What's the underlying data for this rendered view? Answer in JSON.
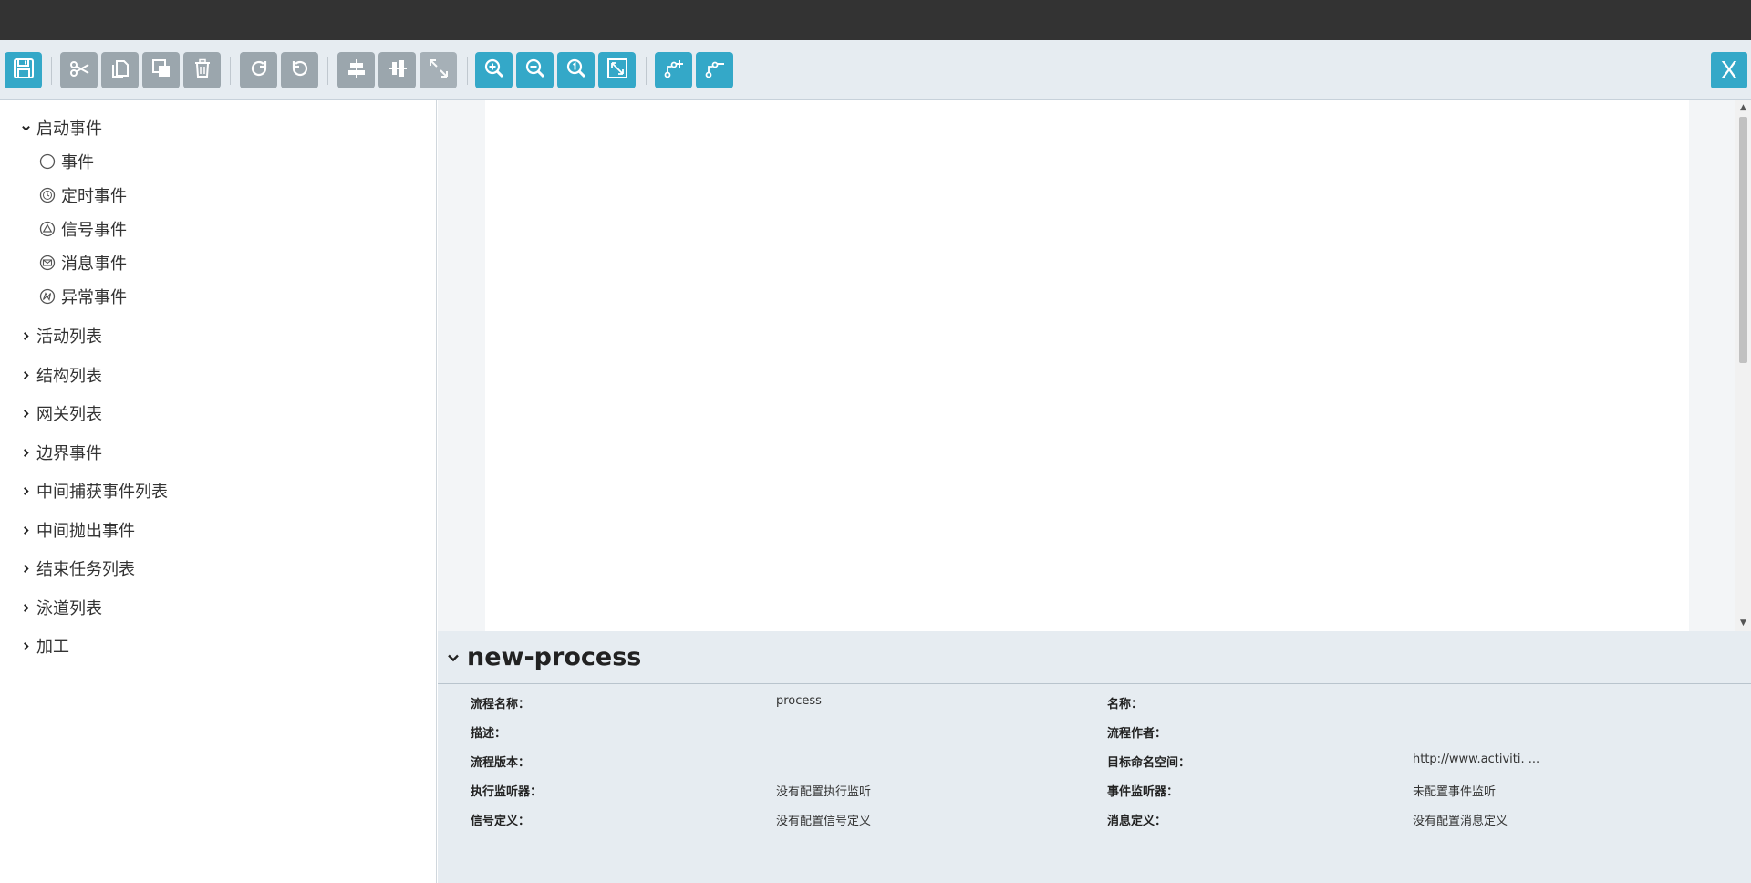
{
  "toolbar": {
    "buttons": [
      {
        "name": "save-button",
        "icon": "save-icon"
      },
      {
        "name": "cut-button",
        "icon": "scissors-icon"
      },
      {
        "name": "copy-button",
        "icon": "copy-icon"
      },
      {
        "name": "paste-button",
        "icon": "paste-icon"
      },
      {
        "name": "delete-button",
        "icon": "trash-icon"
      },
      {
        "name": "redo-button",
        "icon": "redo-icon"
      },
      {
        "name": "undo-button",
        "icon": "undo-icon"
      },
      {
        "name": "align-horizontal-button",
        "icon": "align-horizontal-icon"
      },
      {
        "name": "align-vertical-button",
        "icon": "align-vertical-icon"
      },
      {
        "name": "same-size-button",
        "icon": "resize-icon"
      },
      {
        "name": "zoom-in-button",
        "icon": "zoom-in-icon"
      },
      {
        "name": "zoom-out-button",
        "icon": "zoom-out-icon"
      },
      {
        "name": "zoom-actual-button",
        "icon": "zoom-actual-icon"
      },
      {
        "name": "zoom-fit-button",
        "icon": "fit-screen-icon"
      },
      {
        "name": "add-bendpoint-button",
        "icon": "add-bendpoint-icon"
      },
      {
        "name": "remove-bendpoint-button",
        "icon": "remove-bendpoint-icon"
      }
    ],
    "close_label": "X"
  },
  "palette": {
    "start_events": {
      "label": "启动事件",
      "expanded": true,
      "items": [
        {
          "label": "事件",
          "icon": "none-start-event-icon"
        },
        {
          "label": "定时事件",
          "icon": "timer-start-event-icon"
        },
        {
          "label": "信号事件",
          "icon": "signal-start-event-icon"
        },
        {
          "label": "消息事件",
          "icon": "message-start-event-icon"
        },
        {
          "label": "异常事件",
          "icon": "error-start-event-icon"
        }
      ]
    },
    "groups": [
      {
        "label": "活动列表"
      },
      {
        "label": "结构列表"
      },
      {
        "label": "网关列表"
      },
      {
        "label": "边界事件"
      },
      {
        "label": "中间捕获事件列表"
      },
      {
        "label": "中间抛出事件"
      },
      {
        "label": "结束任务列表"
      },
      {
        "label": "泳道列表"
      },
      {
        "label": "加工"
      }
    ]
  },
  "properties": {
    "title": "new-process",
    "rows": [
      {
        "l1": "流程名称：",
        "v1": "process",
        "l2": "名称：",
        "v2": ""
      },
      {
        "l1": "描述：",
        "v1": "",
        "l2": "流程作者：",
        "v2": ""
      },
      {
        "l1": "流程版本：",
        "v1": "",
        "l2": "目标命名空间：",
        "v2": "http://www.activiti. ..."
      },
      {
        "l1": "执行监听器：",
        "v1": "没有配置执行监听",
        "l2": "事件监听器：",
        "v2": "未配置事件监听"
      },
      {
        "l1": "信号定义：",
        "v1": "没有配置信号定义",
        "l2": "消息定义：",
        "v2": "没有配置消息定义"
      }
    ]
  },
  "colors": {
    "accent": "#34a8c8",
    "disabled": "#9ba6ad",
    "topbar": "#333333",
    "panel_bg": "#e6ecf1"
  }
}
